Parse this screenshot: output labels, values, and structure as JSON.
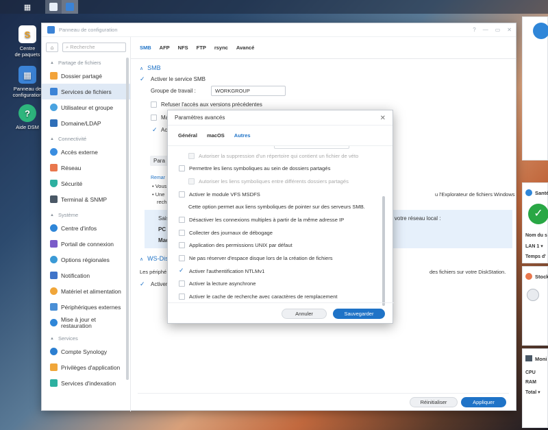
{
  "desktop": {
    "icons": [
      {
        "label_line1": "Centre",
        "label_line2": "de paquets"
      },
      {
        "label_line1": "Panneau de",
        "label_line2": "configuration"
      },
      {
        "label_line1": "Aide DSM",
        "label_line2": ""
      }
    ]
  },
  "window": {
    "title": "Panneau de configuration",
    "search_placeholder": "Recherche",
    "sidebar": {
      "sections": [
        {
          "title": "Partage de fichiers",
          "items": [
            "Dossier partagé",
            "Services de fichiers",
            "Utilisateur et groupe",
            "Domaine/LDAP"
          ]
        },
        {
          "title": "Connectivité",
          "items": [
            "Accès externe",
            "Réseau",
            "Sécurité",
            "Terminal & SNMP"
          ]
        },
        {
          "title": "Système",
          "items": [
            "Centre d'infos",
            "Portail de connexion",
            "Options régionales",
            "Notification",
            "Matériel et alimentation",
            "Périphériques externes",
            "Mise à jour et restauration"
          ]
        },
        {
          "title": "Services",
          "items": [
            "Compte Synology",
            "Privilèges d'application",
            "Services d'indexation"
          ]
        }
      ],
      "selected": "Services de fichiers"
    },
    "tabs": [
      "SMB",
      "AFP",
      "NFS",
      "FTP",
      "rsync",
      "Avancé"
    ],
    "active_tab": "SMB",
    "smb": {
      "section_title": "SMB",
      "enable_label": "Activer le service SMB",
      "workgroup_label": "Groupe de travail :",
      "workgroup_value": "WORKGROUP",
      "deny_prev_label": "Refuser l'accès aux versions précédentes",
      "partial_ma": "Ma",
      "partial_ac": "Ac",
      "partial_para": "Para",
      "remark_label": "Remar",
      "bullet1": "• Vous",
      "bullet2": "• Une",
      "bullet2_right": "u l'Explorateur de fichiers Windows pour",
      "bullet2_cont": "rech",
      "info_sai": "Sais",
      "info_right": "r votre réseau local :",
      "info_pc": "PC",
      "info_mac": "Mac"
    },
    "wsd": {
      "section_title": "WS-Dis",
      "desc_left": "Les périphé",
      "desc_right": "des fichiers sur votre DiskStation.",
      "enable_partial": "Activer"
    },
    "footer": {
      "reset": "Réinitialiser",
      "apply": "Appliquer"
    }
  },
  "modal": {
    "title": "Paramètres avancés",
    "tabs": [
      "Général",
      "macOS",
      "Autres"
    ],
    "active_tab": "Autres",
    "rows": [
      {
        "label": "Autoriser la suppression d'un répertoire qui contient un fichier de véto",
        "checked": false,
        "disabled": true,
        "indent": true,
        "checkbox": true
      },
      {
        "label": "Permettre les liens symboliques au sein de dossiers partagés",
        "checked": false,
        "disabled": false,
        "indent": false,
        "checkbox": true
      },
      {
        "label": "Autoriser les liens symboliques entre différents dossiers partagés",
        "checked": false,
        "disabled": true,
        "indent": true,
        "checkbox": true
      },
      {
        "label": "Activer le module VFS MSDFS",
        "checked": false,
        "disabled": false,
        "indent": false,
        "checkbox": true
      },
      {
        "label": "Cette option permet aux liens symboliques de pointer sur des serveurs SMB.",
        "checked": false,
        "disabled": false,
        "indent": false,
        "checkbox": false
      },
      {
        "label": "Désactiver les connexions multiples à partir de la même adresse IP",
        "checked": false,
        "disabled": false,
        "indent": false,
        "checkbox": true
      },
      {
        "label": "Collecter des journaux de débogage",
        "checked": false,
        "disabled": false,
        "indent": false,
        "checkbox": true
      },
      {
        "label": "Application des permissions UNIX par défaut",
        "checked": false,
        "disabled": false,
        "indent": false,
        "checkbox": true
      },
      {
        "label": "Ne pas réserver d'espace disque lors de la création de fichiers",
        "checked": false,
        "disabled": false,
        "indent": false,
        "checkbox": true
      },
      {
        "label": "Activer l'authentification NTLMv1",
        "checked": true,
        "disabled": false,
        "indent": false,
        "checkbox": true
      },
      {
        "label": "Activer la lecture asynchrone",
        "checked": false,
        "disabled": false,
        "indent": false,
        "checkbox": true
      },
      {
        "label": "Activer le cache de recherche avec caractères de remplacement",
        "checked": false,
        "disabled": false,
        "indent": false,
        "checkbox": true
      }
    ],
    "cancel": "Annuler",
    "save": "Sauvegarder"
  },
  "widgets": {
    "health_partial": "Santé",
    "name_partial": "Nom du s",
    "lan_partial": "LAN 1",
    "time_partial": "Temps d'",
    "storage_partial": "Stock",
    "monitor_partial": "Moni",
    "cpu": "CPU",
    "ram": "RAM",
    "total": "Total"
  },
  "colors": {
    "accent": "#1f73c7",
    "selected_bg": "#dfe9f5",
    "info_bg": "#e6f0fb"
  }
}
